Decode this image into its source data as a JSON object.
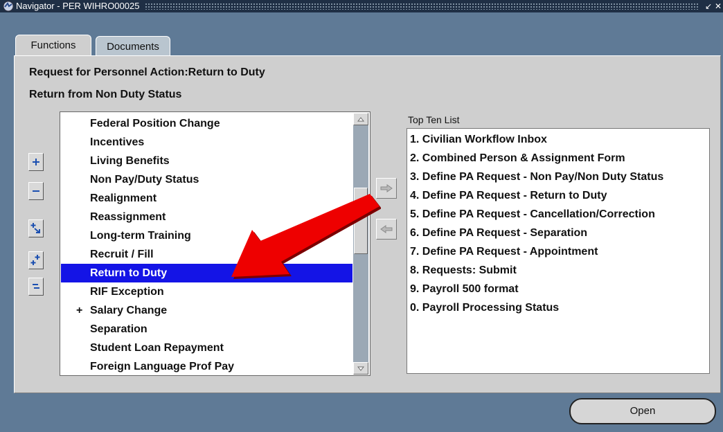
{
  "window": {
    "title": "Navigator - PER WIHRO00025"
  },
  "tabs": [
    {
      "label": "Functions",
      "active": true
    },
    {
      "label": "Documents",
      "active": false
    }
  ],
  "headings": {
    "line1": "Request for Personnel Action:Return to Duty",
    "line2": "Return from Non Duty Status"
  },
  "functions_list": {
    "items": [
      {
        "label": "Federal Position Change",
        "expander": ""
      },
      {
        "label": "Incentives",
        "expander": ""
      },
      {
        "label": "Living Benefits",
        "expander": ""
      },
      {
        "label": "Non Pay/Duty Status",
        "expander": ""
      },
      {
        "label": "Realignment",
        "expander": ""
      },
      {
        "label": "Reassignment",
        "expander": ""
      },
      {
        "label": "Long-term Training",
        "expander": ""
      },
      {
        "label": "Recruit / Fill",
        "expander": ""
      },
      {
        "label": "Return to Duty",
        "expander": "",
        "selected": true
      },
      {
        "label": "RIF Exception",
        "expander": ""
      },
      {
        "label": "Salary Change",
        "expander": "+"
      },
      {
        "label": "Separation",
        "expander": ""
      },
      {
        "label": "Student Loan Repayment",
        "expander": ""
      },
      {
        "label": "Foreign Language Prof Pay",
        "expander": ""
      }
    ]
  },
  "top_ten": {
    "label": "Top Ten List",
    "items": [
      "1. Civilian Workflow Inbox",
      "2. Combined Person & Assignment Form",
      "3. Define PA Request - Non Pay/Non Duty Status",
      "4. Define PA Request - Return to Duty",
      "5. Define PA Request - Cancellation/Correction",
      "6. Define PA Request - Separation",
      "7. Define PA Request - Appointment",
      "8. Requests: Submit",
      "9. Payroll 500 format",
      "0. Payroll Processing Status"
    ]
  },
  "buttons": {
    "open": "Open"
  },
  "colors": {
    "selection": "#1414e6",
    "annotation_arrow": "#ee0000",
    "background": "#5f7a96"
  }
}
